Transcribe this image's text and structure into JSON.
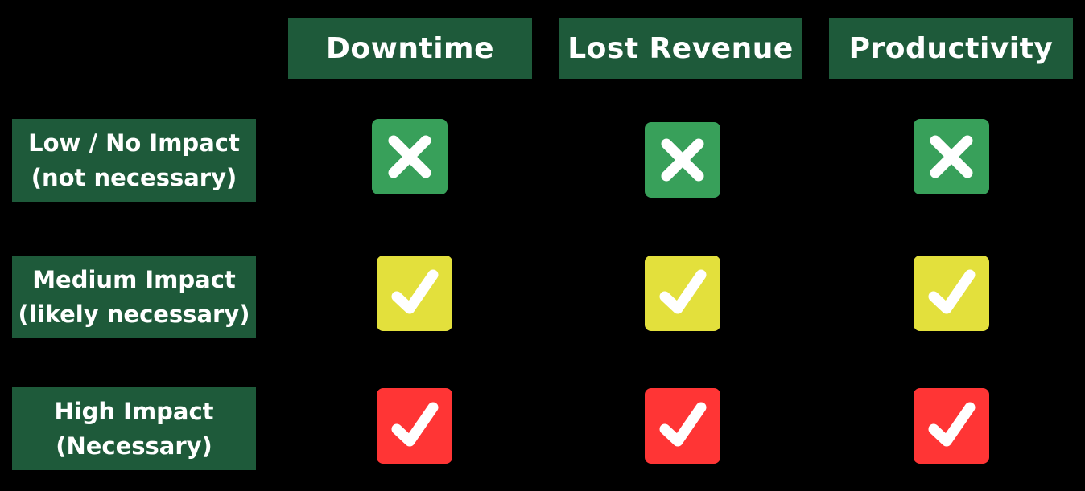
{
  "colors": {
    "background": "#000000",
    "header_fill": "#1e5a3a",
    "text": "#ffffff",
    "low": "#38a05a",
    "medium": "#e3e03c",
    "high": "#ff3535"
  },
  "columns": [
    {
      "label": "Downtime"
    },
    {
      "label": "Lost Revenue"
    },
    {
      "label": "Productivity"
    }
  ],
  "rows": [
    {
      "line1": "Low / No Impact",
      "line2": "(not necessary)",
      "level": "low",
      "cells": [
        {
          "icon": "x-icon",
          "state": "not-necessary"
        },
        {
          "icon": "x-icon",
          "state": "not-necessary"
        },
        {
          "icon": "x-icon",
          "state": "not-necessary"
        }
      ]
    },
    {
      "line1": "Medium Impact",
      "line2": "(likely necessary)",
      "level": "medium",
      "cells": [
        {
          "icon": "check-icon",
          "state": "likely-necessary"
        },
        {
          "icon": "check-icon",
          "state": "likely-necessary"
        },
        {
          "icon": "check-icon",
          "state": "likely-necessary"
        }
      ]
    },
    {
      "line1": "High Impact",
      "line2": "(Necessary)",
      "level": "high",
      "cells": [
        {
          "icon": "check-icon",
          "state": "necessary"
        },
        {
          "icon": "check-icon",
          "state": "necessary"
        },
        {
          "icon": "check-icon",
          "state": "necessary"
        }
      ]
    }
  ]
}
